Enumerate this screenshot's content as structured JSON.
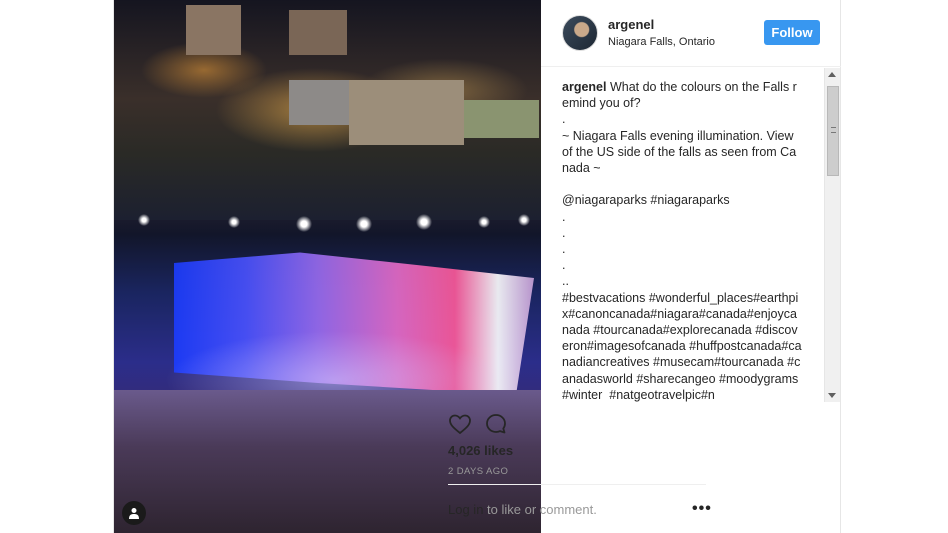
{
  "header": {
    "username": "argenel",
    "location": "Niagara Falls, Ontario",
    "follow_label": "Follow"
  },
  "caption": {
    "username": "argenel",
    "text": " What do the colours on the Falls remind you of?\n.\n~ Niagara Falls evening illumination. View of the US side of the falls as seen from Canada ~\n\n@niagaraparks #niagaraparks\n.\n.\n.\n.\n..\n#bestvacations #wonderful_places#earthpix#canoncanada#niagara#canada#enjoycanada #tourcanada#explorecanada #discoveron#imagesofcanada #huffpostcanada#canadiancreatives #musecam#tourcanada #canadasworld #sharecangeo #moodygrams #winter  #natgeotravelpic#n"
  },
  "actions": {
    "like_icon": "heart-icon",
    "comment_icon": "comment-icon"
  },
  "likes": "4,026 likes",
  "time_ago": "2 DAYS AGO",
  "footer": {
    "login_link": "Log in",
    "login_rest": " to like or comment.",
    "more_label": "•••"
  },
  "colors": {
    "follow_bg": "#3897f0",
    "text": "#262626",
    "muted": "#999999"
  }
}
